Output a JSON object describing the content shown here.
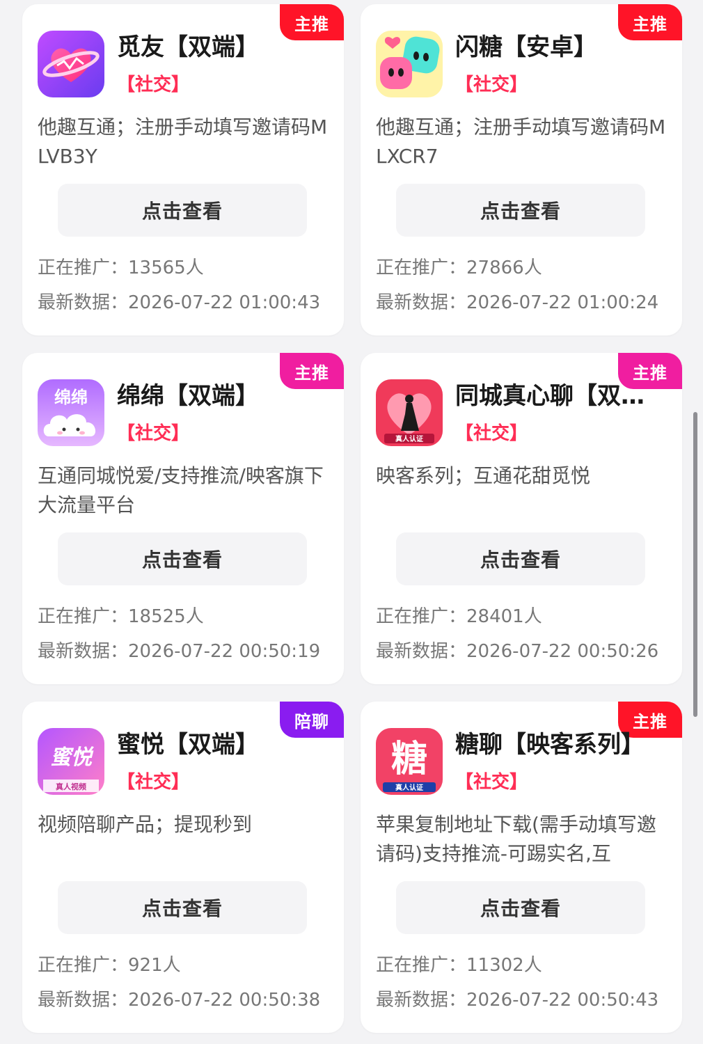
{
  "cards": [
    {
      "badge": "主推",
      "badge_color": "#ff1428",
      "icon": "heart-planet-icon",
      "title": "觅友【双端】",
      "category": "【社交】",
      "description": "他趣互通；注册手动填写邀请码MLVB3Y",
      "button": "点击查看",
      "promo_label": "正在推广：",
      "promo_count": "13565人",
      "updated_label": "最新数据：",
      "updated_time": "2026-07-22 01:00:43"
    },
    {
      "badge": "主推",
      "badge_color": "#ff1428",
      "icon": "candy-faces-icon",
      "title": "闪糖【安卓】",
      "category": "【社交】",
      "description": "他趣互通；注册手动填写邀请码MLXCR7",
      "button": "点击查看",
      "promo_label": "正在推广：",
      "promo_count": "27866人",
      "updated_label": "最新数据：",
      "updated_time": "2026-07-22 01:00:24"
    },
    {
      "badge": "主推",
      "badge_color": "#f01ea0",
      "icon": "cloud-icon",
      "icon_text": "绵绵",
      "title": "绵绵【双端】",
      "category": "【社交】",
      "description": "互通同城悦爱/支持推流/映客旗下大流量平台",
      "button": "点击查看",
      "promo_label": "正在推广：",
      "promo_count": "18525人",
      "updated_label": "最新数据：",
      "updated_time": "2026-07-22 00:50:19"
    },
    {
      "badge": "主推",
      "badge_color": "#f01ea0",
      "icon": "woman-silhouette-icon",
      "icon_text": "真人认证",
      "title": "同城真心聊【双…",
      "category": "【社交】",
      "description": "映客系列；互通花甜觅悦",
      "button": "点击查看",
      "promo_label": "正在推广：",
      "promo_count": "28401人",
      "updated_label": "最新数据：",
      "updated_time": "2026-07-22 00:50:26"
    },
    {
      "badge": "陪聊",
      "badge_color": "#8a1cf0",
      "icon": "miyue-logo-icon",
      "icon_text": "蜜悦",
      "icon_subtext": "真人视频",
      "title": "蜜悦【双端】",
      "category": "【社交】",
      "description": "视频陪聊产品；提现秒到",
      "button": "点击查看",
      "promo_label": "正在推广：",
      "promo_count": "921人",
      "updated_label": "最新数据：",
      "updated_time": "2026-07-22 00:50:38"
    },
    {
      "badge": "主推",
      "badge_color": "#ff1428",
      "icon": "tang-logo-icon",
      "icon_text": "糖",
      "icon_subtext": "真人认证",
      "title": "糖聊【映客系列】",
      "category": "【社交】",
      "description": "苹果复制地址下载(需手动填写邀请码)支持推流-可踢实名,互",
      "button": "点击查看",
      "promo_label": "正在推广：",
      "promo_count": "11302人",
      "updated_label": "最新数据：",
      "updated_time": "2026-07-22 00:50:43"
    }
  ]
}
